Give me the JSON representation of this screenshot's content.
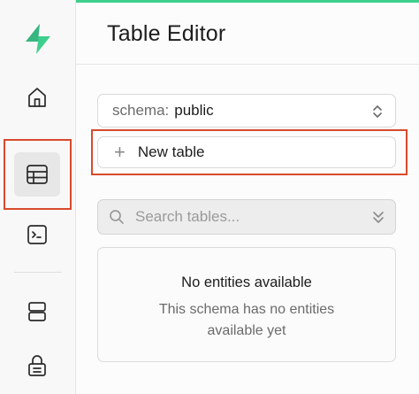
{
  "header": {
    "title": "Table Editor"
  },
  "sidebar": {
    "items": [
      {
        "name": "home",
        "icon": "home-icon"
      },
      {
        "name": "table-editor",
        "icon": "table-icon",
        "active": true
      },
      {
        "name": "sql-editor",
        "icon": "terminal-icon"
      },
      {
        "name": "database",
        "icon": "database-icon"
      },
      {
        "name": "auth",
        "icon": "lock-icon"
      }
    ],
    "logo": "supabase-logo"
  },
  "schema": {
    "prefix": "schema:",
    "value": "public"
  },
  "new_table": {
    "label": "New table"
  },
  "search": {
    "placeholder": "Search tables...",
    "value": ""
  },
  "empty_state": {
    "title": "No entities available",
    "subtitle": "This schema has no entities available yet"
  },
  "colors": {
    "accent": "#3ecf8e",
    "highlight": "#d84a2c"
  }
}
